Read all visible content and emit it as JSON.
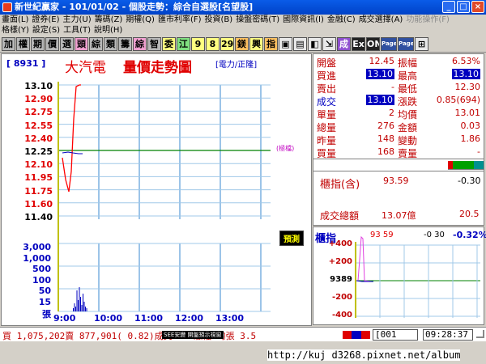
{
  "window": {
    "title": "新世紀贏家 - 101/01/02 - 個股走勢：綜合自選股[名望股]",
    "min_label": "_",
    "max_label": "□",
    "close_label": "×"
  },
  "menu": {
    "row1": [
      "畫面(L)",
      "證券(E)",
      "主力(U)",
      "籌碼(Z)",
      "期權(Q)",
      "匯市利率(F)",
      "投資(B)",
      "操盤密碼(T)",
      "國際資訊(I)",
      "金融(C)",
      "成交選擇(A)",
      "功能操作(F)"
    ],
    "row2": [
      "格樣(Y)",
      "設定(S)",
      "工具(T)",
      "說明(H)"
    ],
    "disabled": [
      "功能操作(F)"
    ]
  },
  "toolbar": {
    "buttons": [
      {
        "label": "加",
        "color": "gray",
        "icon": "add-icon"
      },
      {
        "label": "權",
        "color": "gray",
        "icon": "weight-icon"
      },
      {
        "label": "期",
        "color": "gray",
        "icon": "futures-icon"
      },
      {
        "label": "價",
        "color": "gray",
        "icon": "price-icon"
      },
      {
        "label": "選",
        "color": "gray",
        "icon": "select-icon"
      },
      {
        "label": "頭",
        "color": "pink",
        "icon": "head-icon"
      },
      {
        "label": "綜",
        "color": "gray",
        "icon": "composite-icon"
      },
      {
        "label": "類",
        "color": "gray",
        "icon": "category-icon"
      },
      {
        "label": "籌",
        "color": "gray",
        "icon": "chips-icon"
      },
      {
        "label": "綜",
        "color": "pink",
        "icon": "composite2-icon"
      },
      {
        "label": "智",
        "color": "gray",
        "icon": "smart-icon"
      },
      {
        "label": "委",
        "color": "yel",
        "icon": "order-icon"
      },
      {
        "label": "江",
        "color": "green",
        "icon": "river-icon"
      },
      {
        "label": "9",
        "color": "yel",
        "icon": "nine-icon"
      },
      {
        "label": "8",
        "color": "yel",
        "icon": "eight-icon"
      },
      {
        "label": "29",
        "color": "yel",
        "icon": "twenty-nine-icon"
      },
      {
        "label": "鎂",
        "color": "org",
        "icon": "magnesium-icon"
      },
      {
        "label": "興",
        "color": "yel",
        "icon": "rise-icon"
      },
      {
        "label": "指",
        "color": "org",
        "icon": "index-icon"
      },
      {
        "label": "▣",
        "color": "icon",
        "icon": "grid-icon"
      },
      {
        "label": "▤",
        "color": "icon",
        "icon": "list-icon"
      },
      {
        "label": "◧",
        "color": "icon",
        "icon": "split-icon"
      },
      {
        "label": "⇲",
        "color": "icon",
        "icon": "arrow-icon"
      },
      {
        "label": "成",
        "color": "purp",
        "icon": "trade-icon"
      },
      {
        "label": "Ex",
        "color": "blk",
        "icon": "exit-icon"
      },
      {
        "label": "ON",
        "color": "blk",
        "icon": "on-icon"
      },
      {
        "label": "Page",
        "color": "blue",
        "icon": "page-up-icon"
      },
      {
        "label": "Page",
        "color": "blue",
        "icon": "page-down-icon"
      },
      {
        "label": "⊞",
        "color": "icon",
        "icon": "window-icon"
      }
    ]
  },
  "chart": {
    "stock_code": "[ 8931 ]",
    "stock_name": "大汽電",
    "title": "量價走勢圖",
    "category": "[電力/正隆]",
    "price_axis": {
      "ticks": [
        "13.10",
        "12.90",
        "12.75",
        "12.55",
        "12.40",
        "12.25",
        "12.10",
        "11.95",
        "11.75",
        "11.60",
        "11.40"
      ],
      "colors": [
        "#000000",
        "#e00000",
        "#e00000",
        "#e00000",
        "#e00000",
        "#000000",
        "#e00000",
        "#e00000",
        "#e00000",
        "#e00000",
        "#000000"
      ],
      "ref_price": "12.25",
      "ref_label": "(極檔)"
    },
    "volume_axis": {
      "ticks": [
        "3,000",
        "1,000",
        "500",
        "100",
        "50",
        "15",
        "張"
      ]
    },
    "time_axis": [
      "9:00",
      "10:00",
      "11:00",
      "12:00",
      "13:00"
    ],
    "predict_button": "預測",
    "price_series_color": "#ff0000",
    "ref_series_color": "#0000c0"
  },
  "quote": {
    "rows": [
      {
        "l1": "開盤",
        "v1": "12.45",
        "l2": "振幅",
        "v2": "6.53%"
      },
      {
        "l1": "買進",
        "v1": "13.10",
        "l2": "最高",
        "v2": "13.10",
        "hl1": true,
        "hl2": true
      },
      {
        "l1": "賣出",
        "v1": "-",
        "l2": "最低",
        "v2": "12.30"
      },
      {
        "l1": "成交",
        "v1": "13.10",
        "l2": "漲跌",
        "v2": "0.85(694)",
        "hl1": true
      },
      {
        "l1": "單量",
        "v1": "2",
        "l2": "均價",
        "v2": "13.01"
      },
      {
        "l1": "總量",
        "v1": "276",
        "l2": "金額",
        "v2": "0.03"
      },
      {
        "l1": "昨量",
        "v1": "148",
        "l2": "變動",
        "v2": "1.86"
      },
      {
        "l1": "買量",
        "v1": "168",
        "l2": "賣量",
        "v2": "-"
      }
    ]
  },
  "index": {
    "label": "櫃指(含)",
    "value": "93.59",
    "change": "-0.30",
    "turnover_label": "成交總額",
    "turnover_value": "13.07億",
    "turnover_ratio": "20.5"
  },
  "index_chart": {
    "label": "櫃指",
    "value": "93 59",
    "change": "-0 30",
    "pct": "-0.32%",
    "ticks": [
      "+400",
      "+200",
      "9389",
      "-200",
      "-400"
    ]
  },
  "status": {
    "quote_line": "買 1,075,202賣 877,901( 0.82)成交 0% 漲幅 均張 3.5",
    "overlay": "SEE安變 開盤預示視窗",
    "code_field": "[001",
    "time": "09:28:37"
  },
  "watermark": "http://kuj d3268.pixnet.net/album"
}
